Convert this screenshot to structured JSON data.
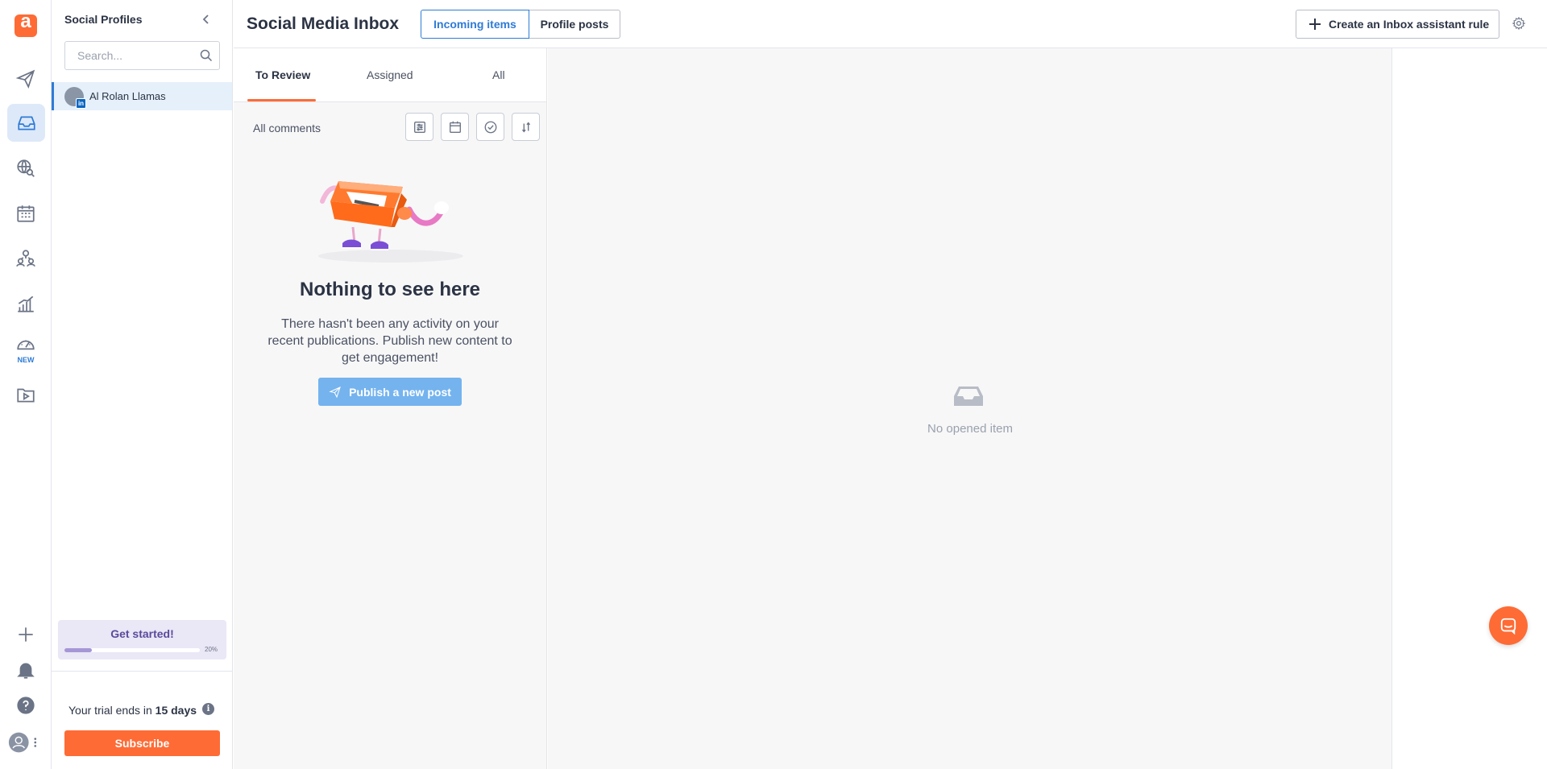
{
  "app": {
    "logo_letter": "a",
    "accent_color": "#ff6b35",
    "active_color": "#2f7bd6"
  },
  "rail": {
    "items": [
      {
        "icon": "paper-plane-icon",
        "active": false
      },
      {
        "icon": "inbox-icon",
        "active": true
      },
      {
        "icon": "globe-search-icon",
        "active": false
      },
      {
        "icon": "calendar-icon",
        "active": false
      },
      {
        "icon": "team-icon",
        "active": false
      },
      {
        "icon": "analytics-icon",
        "active": false
      },
      {
        "icon": "gauge-icon",
        "active": false,
        "badge": "NEW"
      },
      {
        "icon": "media-library-icon",
        "active": false
      }
    ],
    "new_badge": "NEW",
    "bottom": [
      "plus-icon",
      "bell-icon",
      "help-icon",
      "user-avatar-icon"
    ]
  },
  "profiles": {
    "title": "Social Profiles",
    "search_placeholder": "Search...",
    "items": [
      {
        "name": "Al Rolan Llamas",
        "network": "linkedin",
        "network_badge": "in"
      }
    ],
    "get_started": {
      "label": "Get started!",
      "progress_percent": 20,
      "progress_text": "20%"
    },
    "trial": {
      "prefix": "Your trial ends in ",
      "days": "15 days"
    },
    "subscribe_label": "Subscribe"
  },
  "header": {
    "title": "Social Media Inbox",
    "toggle": {
      "incoming": "Incoming items",
      "posts": "Profile posts",
      "selected": "incoming"
    },
    "rule_button": "Create an Inbox assistant rule"
  },
  "list": {
    "tabs": [
      {
        "label": "To Review",
        "active": true
      },
      {
        "label": "Assigned",
        "active": false
      },
      {
        "label": "All",
        "active": false
      }
    ],
    "filter_label": "All comments",
    "tools": [
      "filter-icon",
      "calendar-icon",
      "check-circle-icon",
      "sort-icon"
    ],
    "empty": {
      "title": "Nothing to see here",
      "description": "There hasn't been any activity on your recent publications. Publish new content to get engagement!",
      "button": "Publish a new post"
    }
  },
  "detail": {
    "empty_text": "No opened item"
  }
}
